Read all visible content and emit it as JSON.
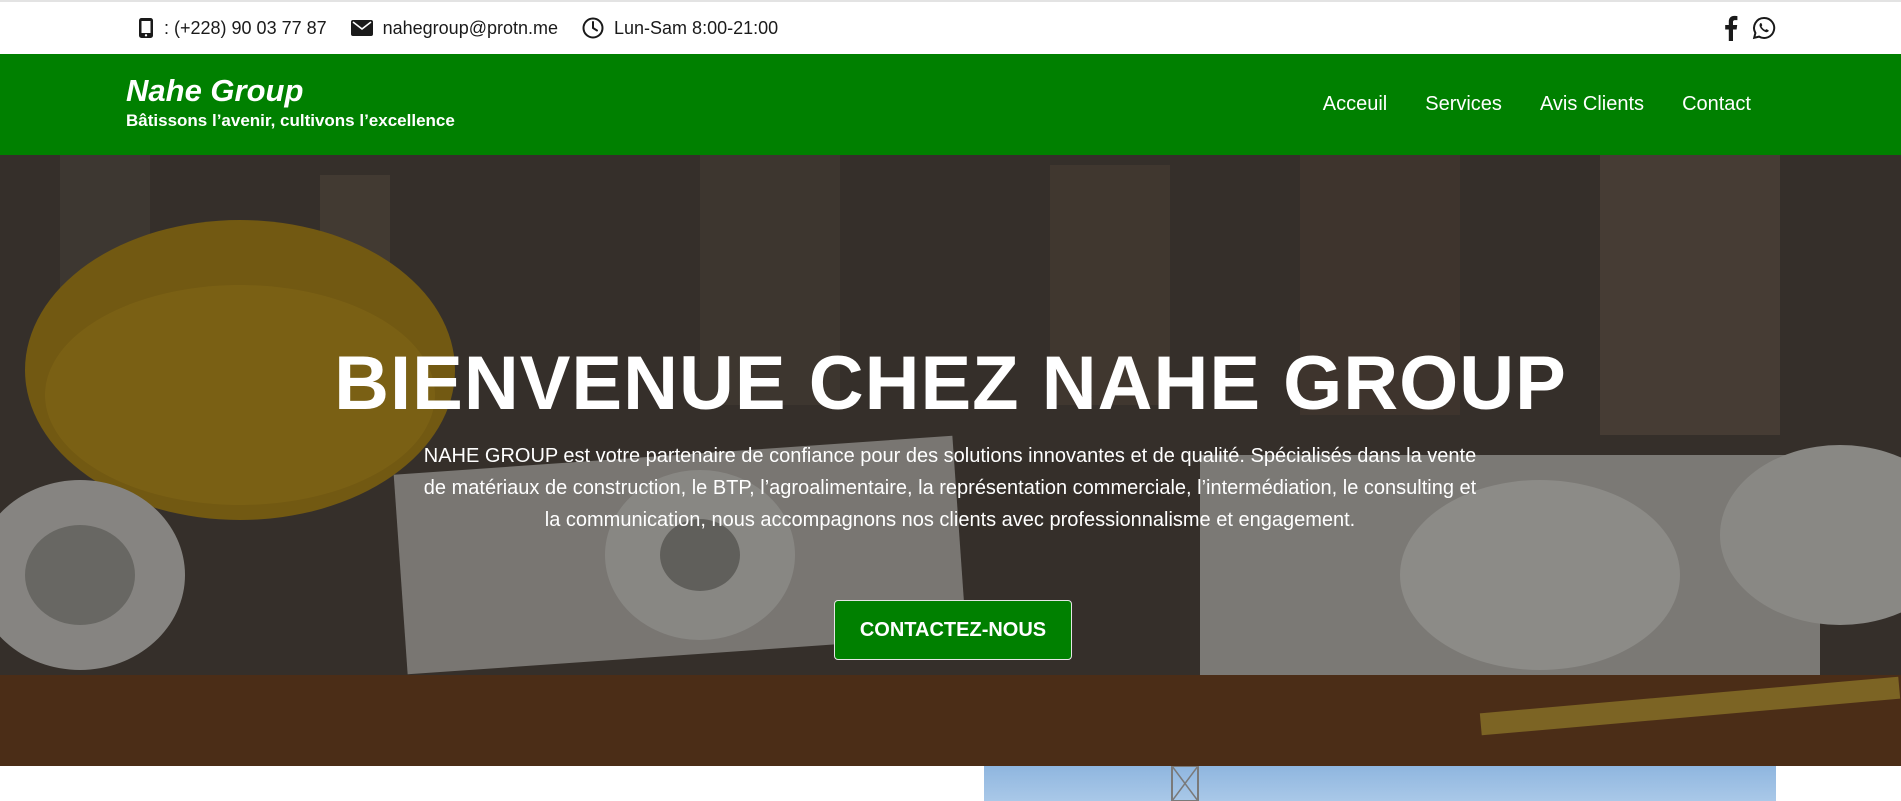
{
  "topbar": {
    "phone": ": (+228) 90 03 77 87",
    "email": "nahegroup@protn.me",
    "hours": "Lun-Sam 8:00-21:00"
  },
  "brand": {
    "name": "Nahe Group",
    "tagline": "Bâtissons l’avenir, cultivons l’excellence"
  },
  "nav": {
    "items": [
      "Acceuil",
      "Services",
      "Avis Clients",
      "Contact"
    ]
  },
  "hero": {
    "title": "BIENVENUE CHEZ NAHE GROUP",
    "text": "NAHE GROUP est votre partenaire de confiance pour des solutions innovantes et de qualité. Spécialisés dans la vente de matériaux de construction, le BTP, l’agroalimentaire, la représentation commerciale, l’intermédiation, le consulting et la communication, nous accompagnons nos clients avec professionnalisme et engagement.",
    "cta": "CONTACTEZ-NOUS"
  },
  "colors": {
    "brand_green": "#008000",
    "topbar_bg": "#ffffff",
    "hero_overlay": "rgba(0,0,0,0.38)"
  },
  "icons": [
    "phone-icon",
    "envelope-icon",
    "clock-icon",
    "facebook-icon",
    "whatsapp-icon"
  ]
}
